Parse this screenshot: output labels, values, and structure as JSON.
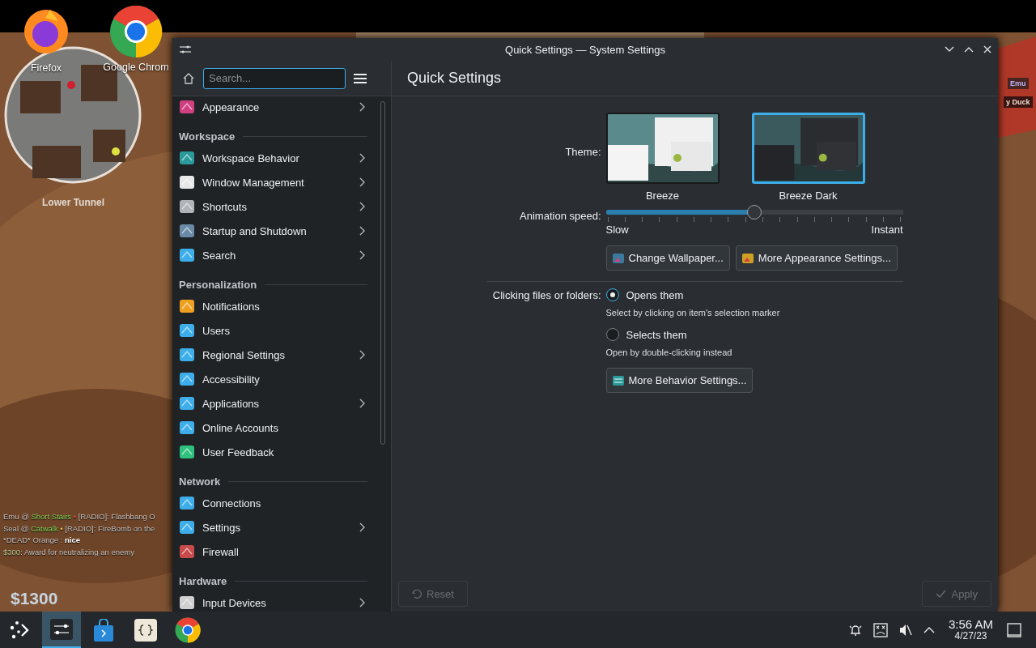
{
  "desktop": {
    "icons": [
      {
        "label": "Firefox"
      },
      {
        "label": "Google Chrom"
      }
    ]
  },
  "game_hud": {
    "location": "Lower Tunnel",
    "money": "$1300",
    "tags": [
      "Emu",
      "y Duck"
    ],
    "chat": [
      [
        {
          "text": "Emu @ ",
          "kind": "text"
        },
        {
          "text": "Short Stairs",
          "kind": "place"
        },
        {
          "text": " • ",
          "kind": "alert"
        },
        {
          "text": "[RADIO]: Flashbang O",
          "kind": "text"
        }
      ],
      [
        {
          "text": "Seal @ ",
          "kind": "text"
        },
        {
          "text": "Catwalk",
          "kind": "place"
        },
        {
          "text": " • ",
          "kind": "caution"
        },
        {
          "text": "[RADIO]: FireBomb on the",
          "kind": "text"
        }
      ],
      [
        {
          "text": "*DEAD* Orange : ",
          "kind": "text"
        },
        {
          "text": "nice",
          "kind": "emphasis"
        }
      ],
      [
        {
          "text": "$300",
          "kind": "reward"
        },
        {
          "text": ": Award for neutralizing an enemy",
          "kind": "text"
        }
      ]
    ]
  },
  "window": {
    "title": "Quick Settings — System Settings"
  },
  "sidebar": {
    "search": {
      "placeholder": "Search..."
    },
    "items": [
      {
        "kind": "item",
        "label": "Appearance",
        "arrow": true
      },
      {
        "kind": "section",
        "label": "Workspace"
      },
      {
        "kind": "item",
        "label": "Workspace Behavior",
        "arrow": true
      },
      {
        "kind": "item",
        "label": "Window Management",
        "arrow": true
      },
      {
        "kind": "item",
        "label": "Shortcuts",
        "arrow": true
      },
      {
        "kind": "item",
        "label": "Startup and Shutdown",
        "arrow": true
      },
      {
        "kind": "item",
        "label": "Search",
        "arrow": true
      },
      {
        "kind": "section",
        "label": "Personalization"
      },
      {
        "kind": "item",
        "label": "Notifications",
        "arrow": false
      },
      {
        "kind": "item",
        "label": "Users",
        "arrow": false
      },
      {
        "kind": "item",
        "label": "Regional Settings",
        "arrow": true
      },
      {
        "kind": "item",
        "label": "Accessibility",
        "arrow": false
      },
      {
        "kind": "item",
        "label": "Applications",
        "arrow": true
      },
      {
        "kind": "item",
        "label": "Online Accounts",
        "arrow": false
      },
      {
        "kind": "item",
        "label": "User Feedback",
        "arrow": false
      },
      {
        "kind": "section",
        "label": "Network"
      },
      {
        "kind": "item",
        "label": "Connections",
        "arrow": false
      },
      {
        "kind": "item",
        "label": "Settings",
        "arrow": true
      },
      {
        "kind": "item",
        "label": "Firewall",
        "arrow": false
      },
      {
        "kind": "section",
        "label": "Hardware"
      },
      {
        "kind": "item",
        "label": "Input Devices",
        "arrow": true
      }
    ]
  },
  "content": {
    "heading": "Quick Settings",
    "theme": {
      "label": "Theme:",
      "options": [
        {
          "name": "Breeze",
          "kind": "light",
          "selected": false
        },
        {
          "name": "Breeze Dark",
          "kind": "dark",
          "selected": true
        }
      ]
    },
    "animation": {
      "label": "Animation speed:",
      "level": 0.5,
      "min_label": "Slow",
      "max_label": "Instant"
    },
    "appearance_buttons": [
      "Change Wallpaper...",
      "More Appearance Settings..."
    ],
    "clicking": {
      "label": "Clicking files or folders:",
      "options": [
        {
          "label": "Opens them",
          "hint": "Select by clicking on item's selection marker",
          "selected": true
        },
        {
          "label": "Selects them",
          "hint": "Open by double-clicking instead",
          "selected": false
        }
      ]
    },
    "behavior_button": "More Behavior Settings..."
  },
  "footer": {
    "reset": {
      "label": "Reset",
      "disabled": true
    },
    "apply": {
      "label": "Apply",
      "disabled": true
    }
  },
  "taskbar": {
    "apps": [
      {
        "selected": false
      },
      {
        "selected": true
      },
      {
        "selected": false
      },
      {
        "selected": false
      },
      {
        "selected": false
      }
    ],
    "clock": {
      "time": "3:56 AM",
      "date": "4/27/23"
    }
  }
}
